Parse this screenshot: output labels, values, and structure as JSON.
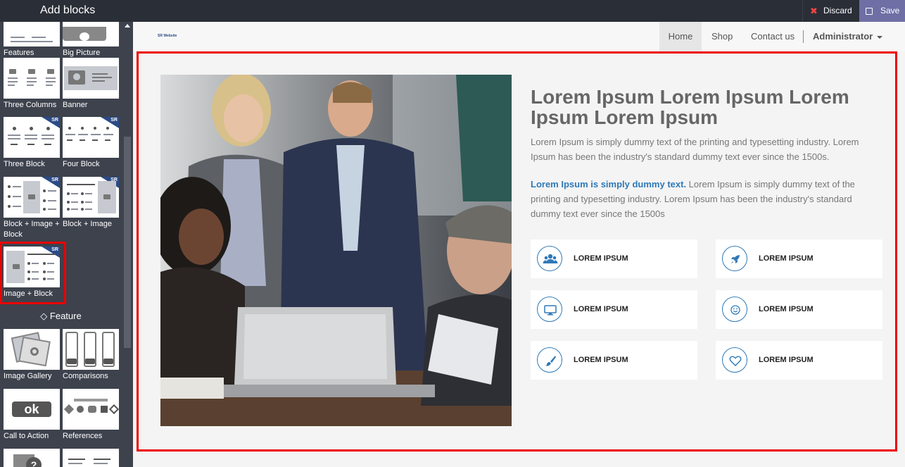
{
  "sidebar": {
    "title": "Add blocks",
    "blocks": [
      {
        "label": "Features"
      },
      {
        "label": "Big Picture"
      },
      {
        "label": "Three Columns"
      },
      {
        "label": "Banner"
      },
      {
        "label": "Three Block"
      },
      {
        "label": "Four Block"
      },
      {
        "label": "Block + Image + Block"
      },
      {
        "label": "Block + Image"
      },
      {
        "label": "Image + Block"
      },
      {
        "label": "Image Gallery"
      },
      {
        "label": "Comparisons"
      },
      {
        "label": "Call to Action"
      },
      {
        "label": "References"
      }
    ],
    "badge": "SR",
    "cta_text": "ok",
    "feature_heading": "Feature"
  },
  "topbar": {
    "discard": "Discard",
    "save": "Save"
  },
  "site": {
    "logo": "SR Website",
    "nav": {
      "home": "Home",
      "shop": "Shop",
      "contact": "Contact us",
      "admin": "Administrator"
    },
    "headline": "Lorem Ipsum Lorem Ipsum Lorem Ipsum Lorem Ipsum",
    "para1": "Lorem Ipsum is simply dummy text of the printing and typesetting industry. Lorem Ipsum has been the industry's standard dummy text ever since the 1500s.",
    "para2_bold": "Lorem Ipsum is simply dummy text.",
    "para2_rest": " Lorem Ipsum is simply dummy text of the printing and typesetting industry. Lorem Ipsum has been the industry's standard dummy text ever since the 1500s",
    "features": [
      {
        "label": "LOREM IPSUM",
        "icon": "users-icon"
      },
      {
        "label": "LOREM IPSUM",
        "icon": "rocket-icon"
      },
      {
        "label": "LOREM IPSUM",
        "icon": "monitor-icon"
      },
      {
        "label": "LOREM IPSUM",
        "icon": "smile-icon"
      },
      {
        "label": "LOREM IPSUM",
        "icon": "brush-icon"
      },
      {
        "label": "LOREM IPSUM",
        "icon": "heart-icon"
      }
    ]
  },
  "colors": {
    "accent": "#2f79b8",
    "highlight": "#ee0000",
    "save_bg": "#6f6fa6"
  }
}
